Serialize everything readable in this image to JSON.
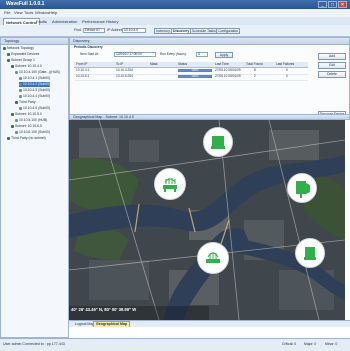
{
  "app": {
    "title": "WaveFull 1.0.0.1",
    "window_controls": [
      "_",
      "□",
      "✕"
    ]
  },
  "menu": [
    "File",
    "View",
    "Tools",
    "Window",
    "Help"
  ],
  "tabs": [
    {
      "label": "Network Control",
      "active": true
    },
    {
      "label": "Faults",
      "active": false
    },
    {
      "label": "Administration",
      "active": false
    },
    {
      "label": "Performance History",
      "active": false
    }
  ],
  "toolbar": {
    "find_label": "Find",
    "find_value": "Device ID",
    "ip_label": "IP Address",
    "ip_value": "10.10.4.0",
    "refresh_label": "Refresh",
    "sub_tabs": [
      "Inventory",
      "Discovery",
      "Schedule Tasks",
      "Configuration"
    ]
  },
  "topology": {
    "header": "Topology",
    "items": [
      {
        "label": "Network Topology",
        "selected": false,
        "color": "#2e7d32"
      },
      {
        "label": "Expanded Devices",
        "selected": false,
        "color": "#2e7d32"
      },
      {
        "label": "Subnet Group 1",
        "selected": false,
        "color": "#2e7d32"
      },
      {
        "label": "Subnet: 10.10.4.0",
        "selected": false,
        "color": "#2e7d32"
      },
      {
        "label": "10.10.4.100 (Gate...)(HUB)",
        "selected": false,
        "color": "#4caf50"
      },
      {
        "label": "10.10.4.1 (Sub00)",
        "selected": false,
        "color": "#4caf50"
      },
      {
        "label": "10.10.4.2 (Sub00)",
        "selected": true,
        "color": "#4caf50"
      },
      {
        "label": "10.10.4.3 (Sub00)",
        "selected": false,
        "color": "#4caf50"
      },
      {
        "label": "10.10.4.4 (Sub00)",
        "selected": false,
        "color": "#4caf50"
      },
      {
        "label": "Third Party",
        "selected": false,
        "color": "#2e7d32"
      },
      {
        "label": "10.10.4.5 (Sub00)",
        "selected": false,
        "color": "#4caf50"
      },
      {
        "label": "Subnet: 10.10.5.0",
        "selected": false,
        "color": "#2e7d32"
      },
      {
        "label": "10.10.5.100 (HUB)",
        "selected": false,
        "color": "#4caf50"
      },
      {
        "label": "Subnet: 10.10.6.0",
        "selected": false,
        "color": "#2e7d32"
      },
      {
        "label": "10.10.6.100 (Sub00)",
        "selected": false,
        "color": "#4caf50"
      },
      {
        "label": "Third Party (no subnet)",
        "selected": false,
        "color": "#2e7d32"
      }
    ]
  },
  "discovery": {
    "header": "Discovery",
    "section": "Periodic Discovery",
    "next_start_label": "Next Start At:",
    "next_start_value": "12/04/10 17:00:04",
    "run_every_label": "Run Every (hours):",
    "run_every_value": "4",
    "apply_label": "Apply",
    "columns": [
      "From IP",
      "To IP",
      "Mask",
      "Status",
      "Last Time",
      "Total Found",
      "Last Failures"
    ],
    "rows": [
      {
        "from": "10.10.4.1",
        "to": "10.10.4.254",
        "mask": "",
        "status": "100%",
        "status_pct": 100,
        "last": "27/06.10 05/01/09",
        "total": "8",
        "fail": "0"
      },
      {
        "from": "10.10.5.1",
        "to": "10.10.5.254",
        "mask": "",
        "status": "100%",
        "status_pct": 100,
        "last": "27/06.10 05/01/09",
        "total": "2",
        "fail": "0"
      }
    ],
    "side_buttons": [
      "Add",
      "Edit",
      "Delete",
      "Discover Device"
    ]
  },
  "map": {
    "header": "Geographical Map - Subnet: 10.10.4.0",
    "coordinates": "40° 26' 43.46\" N, 80° 00' 39.99\" W",
    "view_tabs": [
      {
        "label": "Logical Map",
        "active": false
      },
      {
        "label": "Geographical Map",
        "active": true
      }
    ]
  },
  "statusbar": {
    "left": "User admin Connected to : pp.177.443",
    "right": [
      "Critical: 0",
      "Major: 0",
      "Minor: 0"
    ]
  },
  "colors": {
    "accent": "#2a558f",
    "node_green": "#2fb04a",
    "status_ok": "#3f73c7"
  }
}
